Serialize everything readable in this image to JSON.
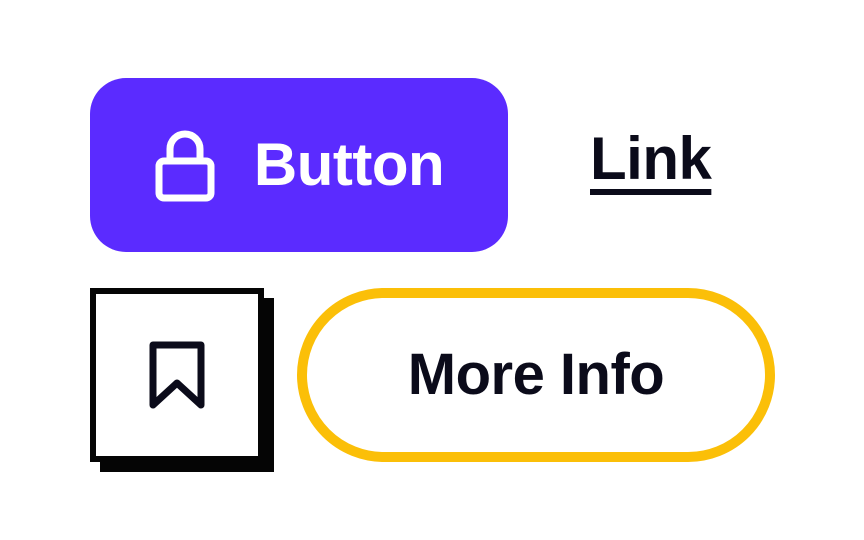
{
  "primary_button": {
    "label": "Button",
    "icon": "lock-icon",
    "background": "#5b2bff",
    "text_color": "#ffffff"
  },
  "link": {
    "label": "Link",
    "color": "#0b0b1a"
  },
  "bookmark_button": {
    "icon": "bookmark-icon",
    "border_color": "#050505"
  },
  "outline_button": {
    "label": "More Info",
    "border_color": "#fbbf08",
    "text_color": "#0b0b1a"
  }
}
